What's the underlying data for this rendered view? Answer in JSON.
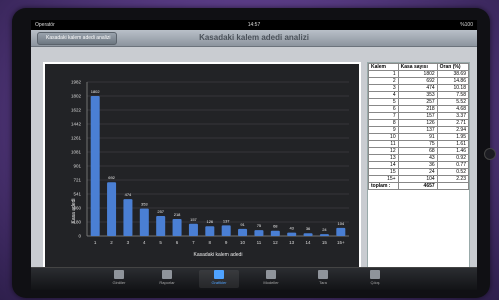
{
  "status": {
    "carrier": "Operatör",
    "time": "14:57",
    "battery": "%100"
  },
  "nav": {
    "back_label": "Kasadaki kalem adedi analizi",
    "title": "Kasadaki kalem adedi analizi"
  },
  "table": {
    "headers": [
      "Kalem",
      "Kasa sayısı",
      "Oran (%)"
    ],
    "rows": [
      [
        "1",
        "1802",
        "38.69"
      ],
      [
        "2",
        "692",
        "14.86"
      ],
      [
        "3",
        "474",
        "10.18"
      ],
      [
        "4",
        "353",
        "7.58"
      ],
      [
        "5",
        "257",
        "5.52"
      ],
      [
        "6",
        "218",
        "4.68"
      ],
      [
        "7",
        "157",
        "3.37"
      ],
      [
        "8",
        "126",
        "2.71"
      ],
      [
        "9",
        "137",
        "2.94"
      ],
      [
        "10",
        "91",
        "1.95"
      ],
      [
        "11",
        "75",
        "1.61"
      ],
      [
        "12",
        "68",
        "1.46"
      ],
      [
        "13",
        "43",
        "0.92"
      ],
      [
        "14",
        "36",
        "0.77"
      ],
      [
        "15",
        "24",
        "0.52"
      ],
      [
        "15+",
        "104",
        "2.23"
      ]
    ],
    "total_label": "toplam :",
    "total_value": "4657"
  },
  "chart_data": {
    "type": "bar",
    "categories": [
      "1",
      "2",
      "3",
      "4",
      "5",
      "6",
      "7",
      "8",
      "9",
      "10",
      "11",
      "12",
      "13",
      "14",
      "15",
      "15+"
    ],
    "values": [
      1802,
      692,
      474,
      353,
      257,
      218,
      157,
      126,
      137,
      91,
      75,
      68,
      43,
      36,
      24,
      104
    ],
    "title": "",
    "xlabel": "Kasadaki kalem adedi",
    "ylabel": "Kasa adedi",
    "yticks": [
      "0",
      "180",
      "360",
      "541",
      "721",
      "901",
      "1081",
      "1261",
      "1442",
      "1622",
      "1802",
      "1982"
    ],
    "ylim": [
      0,
      1982
    ],
    "bar_color": "#4a7fd4",
    "grid": true
  },
  "toolbar": {
    "tabs": [
      {
        "label": "Girdiler",
        "icon": "doc-icon"
      },
      {
        "label": "Raporlar",
        "icon": "report-icon"
      },
      {
        "label": "Grafikler",
        "icon": "chart-icon"
      },
      {
        "label": "Modeller",
        "icon": "grid-icon"
      },
      {
        "label": "Tara",
        "icon": "scan-icon"
      },
      {
        "label": "Çıkış",
        "icon": "exit-icon"
      }
    ]
  }
}
